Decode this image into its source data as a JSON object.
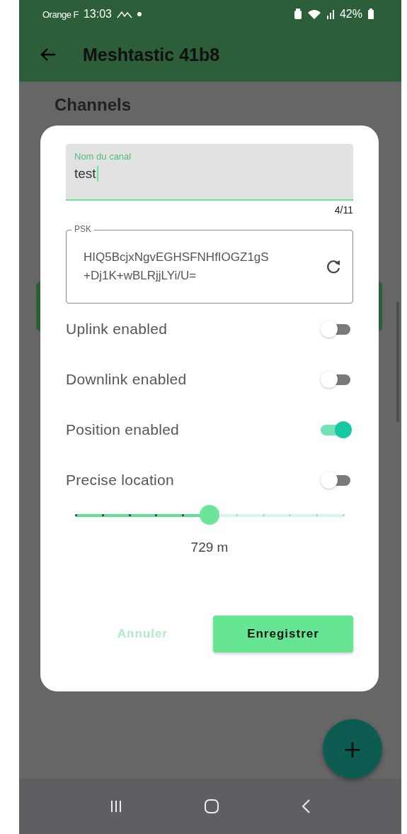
{
  "status_bar": {
    "carrier": "Orange F",
    "time": "13:03",
    "battery": "42%"
  },
  "app_bar": {
    "title": "Meshtastic 41b8"
  },
  "section_title": "Channels",
  "dialog": {
    "name_field": {
      "label": "Nom du canal",
      "value": "test",
      "counter": "4/11"
    },
    "psk_field": {
      "label": "PSK",
      "value": "HIQ5BcjxNgvEGHSFNHfIOGZ1gS+Dj1K+wBLRjjLYi/U="
    },
    "switches": [
      {
        "label": "Uplink enabled",
        "on": false
      },
      {
        "label": "Downlink enabled",
        "on": false
      },
      {
        "label": "Position enabled",
        "on": true
      },
      {
        "label": "Precise location",
        "on": false
      }
    ],
    "slider": {
      "level": 0.5
    },
    "reading": "729 m",
    "buttons": [
      {
        "label": "Annuler",
        "kind": "text"
      },
      {
        "label": "Enregistrer",
        "kind": "filled"
      }
    ]
  },
  "fab": {
    "label": "+"
  }
}
